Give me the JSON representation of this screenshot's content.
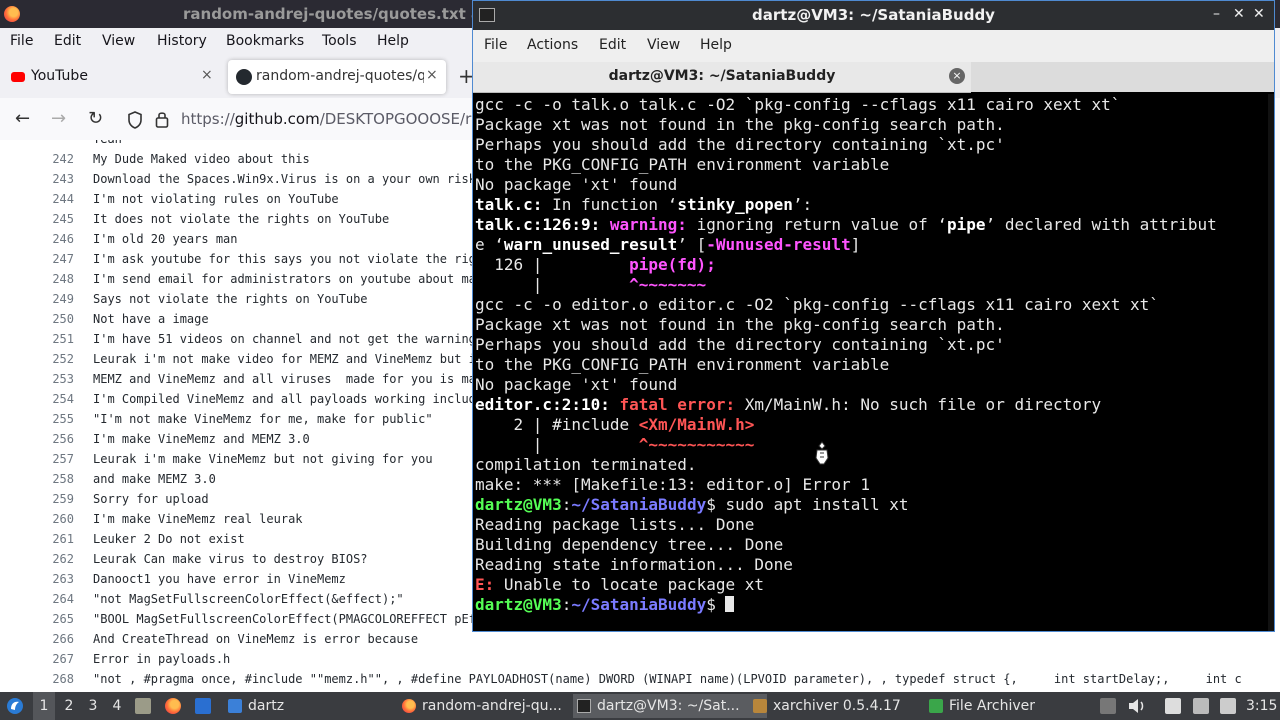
{
  "firefox": {
    "window_title": "random-andrej-quotes/quotes.txt a",
    "menu": [
      "File",
      "Edit",
      "View",
      "History",
      "Bookmarks",
      "Tools",
      "Help"
    ],
    "tabs": [
      {
        "label": "YouTube",
        "close": "×"
      },
      {
        "label": "random-andrej-quotes/qu",
        "close": "×"
      }
    ],
    "new_tab": "+",
    "url_prefix": "https://",
    "url_host": "github.com",
    "url_path": "/DESKTOPGOOOSE/rand",
    "nav": {
      "back": "←",
      "forward": "→",
      "reload": "↻"
    },
    "lines": [
      {
        "n": "",
        "t": "Yeah"
      },
      {
        "n": "242",
        "t": "My Dude Maked video about this"
      },
      {
        "n": "243",
        "t": "Download the Spaces.Win9x.Virus is on a your own risk"
      },
      {
        "n": "244",
        "t": "I'm not violating rules on YouTube"
      },
      {
        "n": "245",
        "t": "It does not violate the rights on YouTube"
      },
      {
        "n": "246",
        "t": "I'm old 20 years man"
      },
      {
        "n": "247",
        "t": "I'm ask youtube for this says you not violate the rig"
      },
      {
        "n": "248",
        "t": "I'm send email for administrators on youtube about ma"
      },
      {
        "n": "249",
        "t": "Says not violate the rights on YouTube"
      },
      {
        "n": "250",
        "t": "Not have a image"
      },
      {
        "n": "251",
        "t": "I'm have 51 videos on channel and not get the warning"
      },
      {
        "n": "252",
        "t": "Leurak i'm not make video for MEMZ and VineMemz but i"
      },
      {
        "n": "253",
        "t": "MEMZ and VineMemz and all viruses  made for you is ma"
      },
      {
        "n": "254",
        "t": "I'm Compiled VineMemz and all payloads working includ"
      },
      {
        "n": "255",
        "t": "\"I'm not make VineMemz for me, make for public\""
      },
      {
        "n": "256",
        "t": "I'm make VineMemz and MEMZ 3.0"
      },
      {
        "n": "257",
        "t": "Leurak i'm make VineMemz but not giving for you"
      },
      {
        "n": "258",
        "t": "and make MEMZ 3.0"
      },
      {
        "n": "259",
        "t": "Sorry for upload"
      },
      {
        "n": "260",
        "t": "I'm make VineMemz real leurak"
      },
      {
        "n": "261",
        "t": "Leuker 2 Do not exist"
      },
      {
        "n": "262",
        "t": "Leurak Can make virus to destroy BIOS?"
      },
      {
        "n": "263",
        "t": "Danooct1 you have error in VineMemz"
      },
      {
        "n": "264",
        "t": "\"not MagSetFullscreenColorEffect(&effect);\""
      },
      {
        "n": "265",
        "t": "\"BOOL MagSetFullscreenColorEffect(PMAGCOLOREFFECT pEf"
      },
      {
        "n": "266",
        "t": "And CreateThread on VineMemz is error because"
      },
      {
        "n": "267",
        "t": "Error in payloads.h"
      },
      {
        "n": "268",
        "t": "\"not , #pragma once, #include \"\"memz.h\"\", , #define PAYLOADHOST(name) DWORD (WINAPI name)(LPVOID parameter), , typedef struct {,     int startDelay;,     int c"
      }
    ]
  },
  "terminal": {
    "window_title": "dartz@VM3: ~/SataniaBuddy",
    "menu": [
      "File",
      "Actions",
      "Edit",
      "View",
      "Help"
    ],
    "tab_label": "dartz@VM3: ~/SataniaBuddy",
    "tab_close": "×",
    "window_buttons": [
      "–",
      "✕",
      "✕"
    ],
    "lines": [
      [
        {
          "t": "gcc -c -o talk.o talk.c -O2 `pkg-config --cflags x11 cairo xext xt`"
        }
      ],
      [
        {
          "t": "Package xt was not found in the pkg-config search path."
        }
      ],
      [
        {
          "t": "Perhaps you should add the directory containing `xt.pc'"
        }
      ],
      [
        {
          "t": "to the PKG_CONFIG_PATH environment variable"
        }
      ],
      [
        {
          "t": "No package 'xt' found"
        }
      ],
      [
        {
          "t": "talk.c:",
          "c": "b"
        },
        {
          "t": " In function "
        },
        {
          "t": "‘"
        },
        {
          "t": "stinky_popen",
          "c": "b"
        },
        {
          "t": "’:"
        }
      ],
      [
        {
          "t": "talk.c:126:9: ",
          "c": "b"
        },
        {
          "t": "warning: ",
          "c": "wm"
        },
        {
          "t": "ignoring return value of ‘"
        },
        {
          "t": "pipe",
          "c": "b"
        },
        {
          "t": "’ declared with attribut"
        }
      ],
      [
        {
          "t": "e ‘"
        },
        {
          "t": "warn_unused_result",
          "c": "b"
        },
        {
          "t": "’ ["
        },
        {
          "t": "-Wunused-result",
          "c": "wm"
        },
        {
          "t": "]"
        }
      ],
      [
        {
          "t": "  126 |         "
        },
        {
          "t": "pipe(fd);",
          "c": "wm"
        }
      ],
      [
        {
          "t": "      |         "
        },
        {
          "t": "^~~~~~~~",
          "c": "wm"
        }
      ],
      [
        {
          "t": "gcc -c -o editor.o editor.c -O2 `pkg-config --cflags x11 cairo xext xt`"
        }
      ],
      [
        {
          "t": "Package xt was not found in the pkg-config search path."
        }
      ],
      [
        {
          "t": "Perhaps you should add the directory containing `xt.pc'"
        }
      ],
      [
        {
          "t": "to the PKG_CONFIG_PATH environment variable"
        }
      ],
      [
        {
          "t": "No package 'xt' found"
        }
      ],
      [
        {
          "t": "editor.c:2:10: ",
          "c": "b"
        },
        {
          "t": "fatal error: ",
          "c": "er"
        },
        {
          "t": "Xm/MainW.h: No such file or directory"
        }
      ],
      [
        {
          "t": "    2 | #include "
        },
        {
          "t": "<Xm/MainW.h>",
          "c": "er"
        }
      ],
      [
        {
          "t": "      |          "
        },
        {
          "t": "^~~~~~~~~~~~",
          "c": "er"
        }
      ],
      [
        {
          "t": "compilation terminated."
        }
      ],
      [
        {
          "t": "make: *** [Makefile:13: editor.o] Error 1"
        }
      ],
      [
        {
          "t": "dartz@VM3",
          "c": "gr"
        },
        {
          "t": ":"
        },
        {
          "t": "~/SataniaBuddy",
          "c": "bl"
        },
        {
          "t": "$ sudo apt install xt"
        }
      ],
      [
        {
          "t": "Reading package lists... Done"
        }
      ],
      [
        {
          "t": "Building dependency tree... Done"
        }
      ],
      [
        {
          "t": "Reading state information... Done"
        }
      ],
      [
        {
          "t": "E: ",
          "c": "er"
        },
        {
          "t": "Unable to locate package xt"
        }
      ],
      [
        {
          "t": "dartz@VM3",
          "c": "gr"
        },
        {
          "t": ":"
        },
        {
          "t": "~/SataniaBuddy",
          "c": "bl"
        },
        {
          "t": "$ "
        }
      ]
    ]
  },
  "taskbar": {
    "workspaces": [
      "1",
      "2",
      "3",
      "4"
    ],
    "tasks": [
      {
        "label": "dartz"
      },
      {
        "label": "random-andrej-qu..."
      },
      {
        "label": "dartz@VM3: ~/Sat..."
      },
      {
        "label": "xarchiver 0.5.4.17"
      },
      {
        "label": "File Archiver"
      }
    ],
    "clock": "3:15"
  },
  "colors": {
    "term_green": "#55ff55",
    "term_blue": "#7b7bff",
    "term_magenta": "#ff55ff",
    "term_red": "#ff5555"
  }
}
